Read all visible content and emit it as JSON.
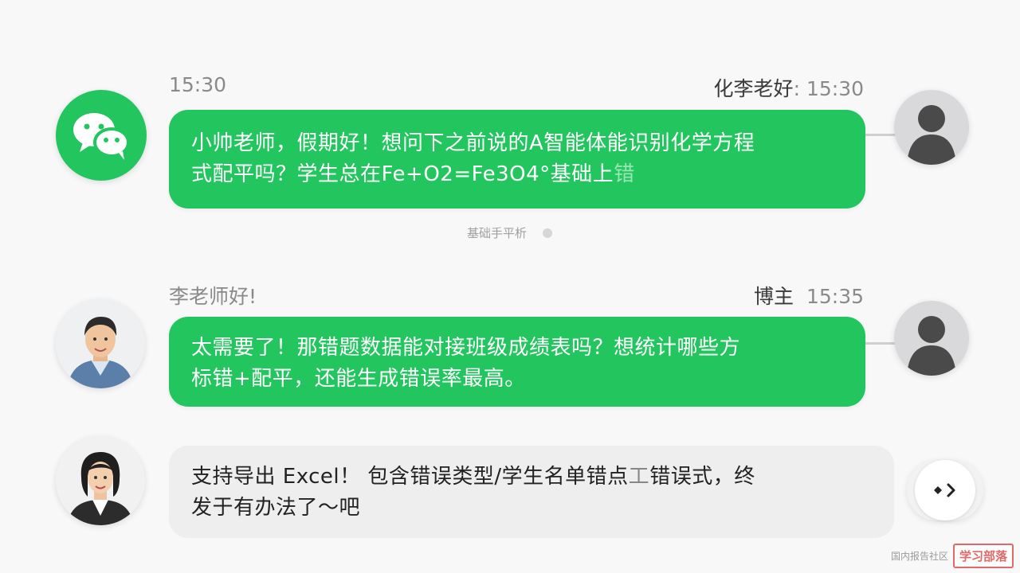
{
  "messages": [
    {
      "left_meta": "15:30",
      "right_name": "化李老好",
      "right_sep": ":",
      "right_time": "15:30",
      "text_line1": "小帅老师，假期好！想问下之前说的A智能体能识别化学方程",
      "text_line2": "式配平吗？学生总在Fe+O2=Fe3O4°基础上",
      "text_faded": "错"
    },
    {
      "left_meta": "李老师好!",
      "right_name": "博主",
      "right_time": "15:35",
      "text_line1": "太需要了！那错题数据能对接班级成绩表吗？想统计哪些方",
      "text_line2": "标错+配平，还能生成错误率最高。"
    },
    {
      "text_line1": "支持导出 Excel！ 包含错误类型/学生名单错点",
      "text_faded": "⼯",
      "text_line1_tail": "错误式，终",
      "text_line2": "发于有办法了～",
      "text_line2_tail": "吧"
    }
  ],
  "center_label": "基础手平析",
  "watermark": {
    "small": "国内报告社区",
    "box": "学习部落"
  },
  "colors": {
    "bubble_green": "#22c55e",
    "wechat_green": "#22c55e",
    "bubble_gray": "#eeeeee"
  },
  "icons": {
    "wechat_logo": "wechat-logo-icon",
    "default_avatar": "user-silhouette-icon",
    "next": "chevron-right-icon"
  }
}
